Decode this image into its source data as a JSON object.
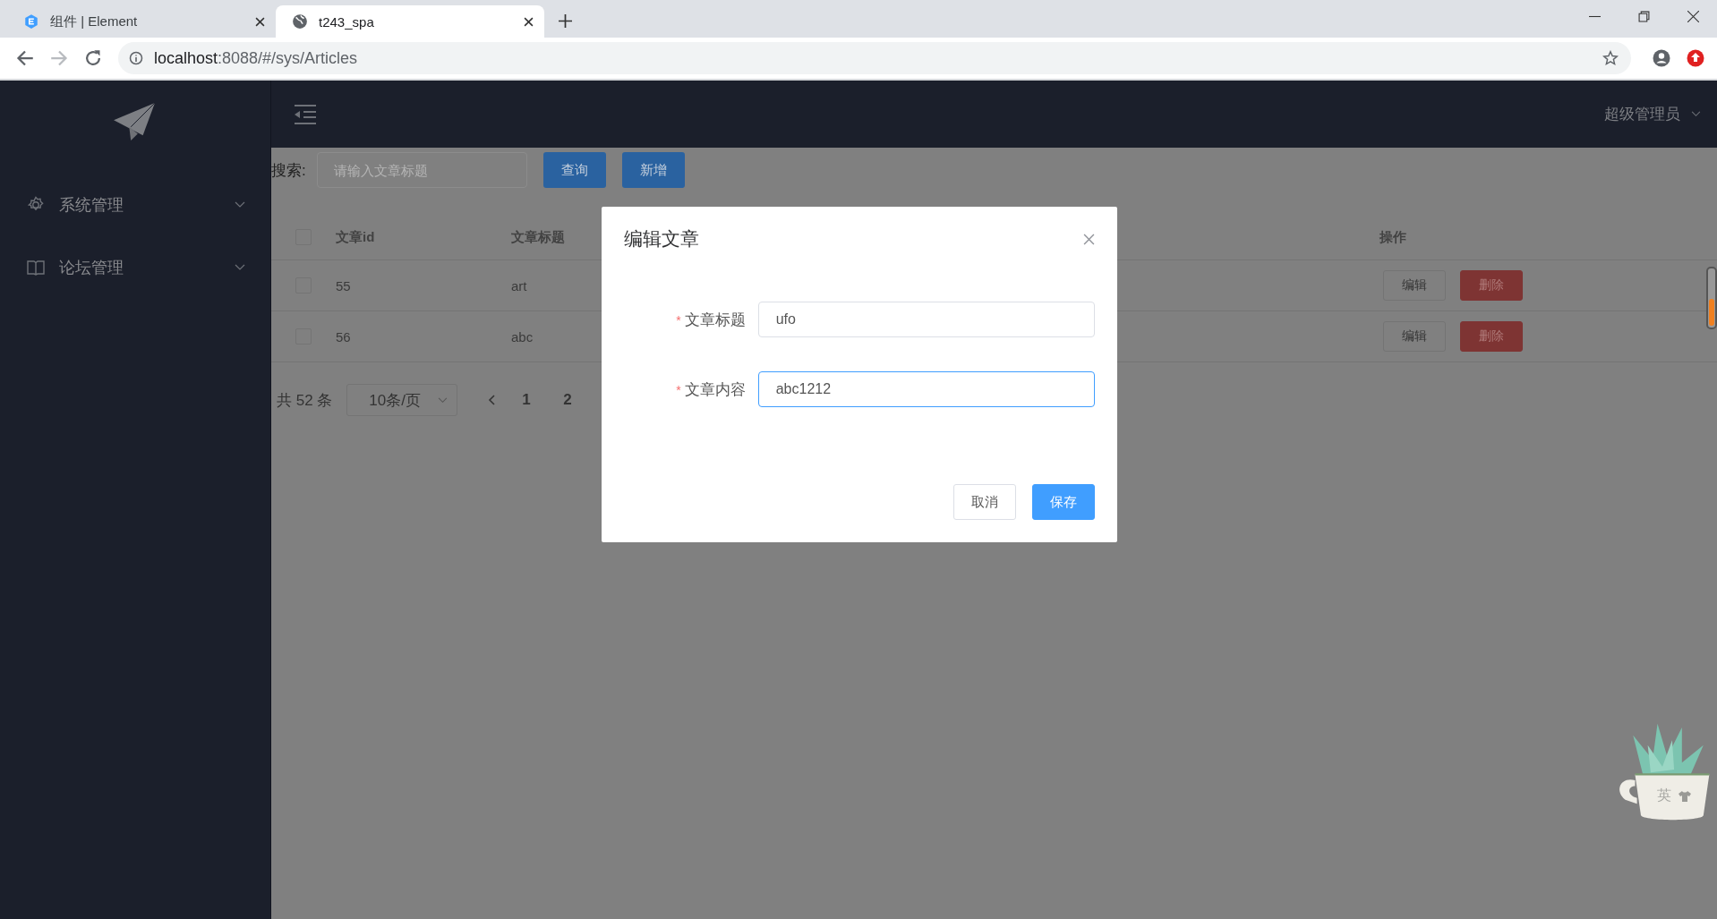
{
  "browser": {
    "tabs": [
      {
        "title": "组件 | Element",
        "selected": false
      },
      {
        "title": "t243_spa",
        "selected": true
      }
    ],
    "url_host": "localhost",
    "url_rest": ":8088/#/sys/Articles",
    "forward_disabled": true
  },
  "sidebar": {
    "items": [
      {
        "label": "系统管理",
        "expanded": false
      },
      {
        "label": "论坛管理",
        "expanded": false
      }
    ]
  },
  "header": {
    "user": "超级管理员"
  },
  "search": {
    "label": "搜索:",
    "placeholder": "请输入文章标题",
    "buttons": [
      "查询",
      "新增"
    ]
  },
  "table": {
    "all_checked": false,
    "columns": [
      "文章id",
      "文章标题",
      "操作"
    ],
    "rows": [
      {
        "checked": false,
        "id": "55",
        "title": "art",
        "actions": [
          "编辑",
          "删除"
        ]
      },
      {
        "checked": false,
        "id": "56",
        "title": "abc",
        "actions": [
          "编辑",
          "删除"
        ]
      }
    ]
  },
  "pagination": {
    "total": "共 52 条",
    "page_size": "10条/页",
    "pages": [
      "1",
      "2"
    ]
  },
  "dialog": {
    "title": "编辑文章",
    "fields": [
      {
        "label": "文章标题",
        "required_mark": "*",
        "value": "ufo",
        "focused": false
      },
      {
        "label": "文章内容",
        "required_mark": "*",
        "value": "abc1212",
        "focused": true
      }
    ],
    "buttons": [
      {
        "label": "取消",
        "kind": "default"
      },
      {
        "label": "保存",
        "kind": "primary"
      }
    ]
  },
  "ime_widget": {
    "label": "英"
  }
}
